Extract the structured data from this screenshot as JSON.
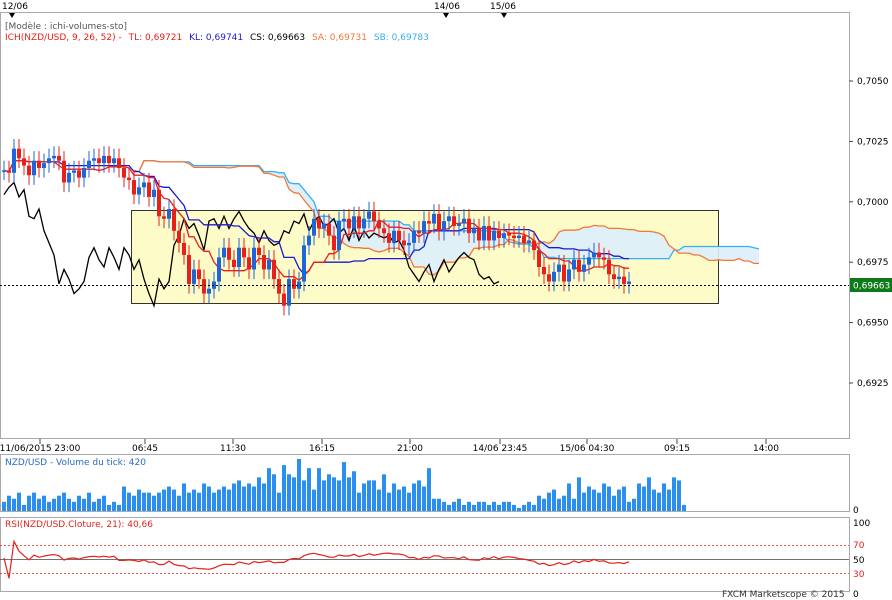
{
  "top_markers": [
    "12/06",
    "14/06",
    "15/06"
  ],
  "header": {
    "model_label": "[Modèle : ichi-volumes-sto]",
    "ichimoku_label": "ICH(NZD/USD, 9, 26, 52) -",
    "tl_label": "TL: 0,69721",
    "kl_label": "KL: 0,69741",
    "cs_label": "CS: 0,69663",
    "sa_label": "SA: 0,69731",
    "sb_label": "SB: 0,69783"
  },
  "price_labels": [
    "0,7050",
    "0,7025",
    "0,7000",
    "0,6975",
    "0,6950",
    "0,6925"
  ],
  "current_price": "0,69663",
  "time_labels": [
    "11/06/2015 23:00",
    "06:45",
    "11:30",
    "16:15",
    "21:00",
    "14/06 23:45",
    "15/06 04:30",
    "09:15",
    "14:00"
  ],
  "volume_panel": {
    "title": "NZD/USD - Volume du tick: 420",
    "zero_label": "0"
  },
  "rsi_panel": {
    "title": "RSI(NZD/USD.Cloture, 21): 40,66",
    "levels": [
      "100",
      "70",
      "50",
      "30",
      "0"
    ]
  },
  "footer": {
    "copyright": "FXCM Marketscope © 2015"
  },
  "colors": {
    "up_candle": "#1e66d8",
    "down_candle": "#e8201a",
    "tenkan": "#e8201a",
    "kijun": "#1a1ad0",
    "chikou": "#000000",
    "span_a": "#f07838",
    "span_b": "#38aff0",
    "cloud": "#dbeefb",
    "box": "#fdfbc8",
    "volume": "#2a8ff0",
    "rsi": "#e8201a"
  },
  "chart_data": {
    "type": "candlestick",
    "symbol": "NZD/USD",
    "ylim": [
      0.69,
      0.7075
    ],
    "close": [
      0.7013,
      0.7012,
      0.7022,
      0.7018,
      0.7015,
      0.7011,
      0.7017,
      0.7014,
      0.7016,
      0.7018,
      0.7019,
      0.7017,
      0.7008,
      0.7012,
      0.7013,
      0.701,
      0.7014,
      0.7017,
      0.7018,
      0.7016,
      0.7019,
      0.7016,
      0.7018,
      0.7014,
      0.701,
      0.7009,
      0.7003,
      0.7006,
      0.7008,
      0.7002,
      0.7005,
      0.6994,
      0.6993,
      0.6997,
      0.6988,
      0.6983,
      0.6978,
      0.6966,
      0.6972,
      0.6968,
      0.6962,
      0.6964,
      0.6967,
      0.6977,
      0.6981,
      0.6976,
      0.6973,
      0.6981,
      0.6977,
      0.6972,
      0.6981,
      0.6978,
      0.6972,
      0.6976,
      0.6968,
      0.6962,
      0.6957,
      0.6968,
      0.6964,
      0.6967,
      0.6982,
      0.6986,
      0.6993,
      0.6989,
      0.6991,
      0.6986,
      0.698,
      0.6992,
      0.6993,
      0.6989,
      0.6994,
      0.6989,
      0.6993,
      0.6996,
      0.6992,
      0.6989,
      0.6987,
      0.6983,
      0.6988,
      0.6984,
      0.6982,
      0.6983,
      0.6988,
      0.6987,
      0.6992,
      0.6991,
      0.6995,
      0.6988,
      0.6992,
      0.6994,
      0.699,
      0.6991,
      0.6993,
      0.6987,
      0.6989,
      0.6984,
      0.699,
      0.6984,
      0.6988,
      0.6985,
      0.6987,
      0.6986,
      0.6985,
      0.6986,
      0.6983,
      0.6984,
      0.698,
      0.6973,
      0.697,
      0.6967,
      0.6971,
      0.6974,
      0.6967,
      0.6972,
      0.6976,
      0.6971,
      0.6974,
      0.6977,
      0.6979,
      0.6977,
      0.6976,
      0.697,
      0.6968,
      0.6969,
      0.6966,
      0.6967
    ],
    "ichimoku": {
      "tenkan_last": 0.69721,
      "kijun_last": 0.69741,
      "chikou_last": 0.69663,
      "senkou_a_last": 0.69731,
      "senkou_b_last": 0.69783
    },
    "volume": [
      3,
      5,
      4,
      6,
      2,
      5,
      6,
      4,
      5,
      3,
      4,
      5,
      6,
      4,
      3,
      5,
      4,
      6,
      3,
      4,
      5,
      2,
      3,
      2,
      8,
      6,
      5,
      7,
      6,
      6,
      5,
      6,
      7,
      8,
      7,
      5,
      9,
      6,
      7,
      6,
      9,
      8,
      6,
      7,
      8,
      7,
      9,
      10,
      8,
      9,
      8,
      11,
      9,
      14,
      12,
      6,
      15,
      12,
      11,
      17,
      10,
      14,
      7,
      14,
      10,
      12,
      11,
      10,
      16,
      11,
      13,
      6,
      9,
      10,
      10,
      7,
      12,
      6,
      9,
      7,
      8,
      6,
      9,
      10,
      8,
      14,
      4,
      4,
      3,
      2,
      3,
      4,
      2,
      3,
      2,
      3,
      3,
      2,
      3,
      2,
      3,
      3,
      2,
      1,
      2,
      3,
      2,
      5,
      4,
      6,
      7,
      4,
      5,
      9,
      4,
      11,
      6,
      8,
      7,
      6,
      9,
      8,
      5,
      7,
      8,
      3,
      4,
      9,
      8,
      11,
      7,
      6,
      9,
      7,
      11,
      10,
      2
    ],
    "rsi_last": 40.66,
    "rsi_levels": [
      70,
      50,
      30
    ]
  }
}
